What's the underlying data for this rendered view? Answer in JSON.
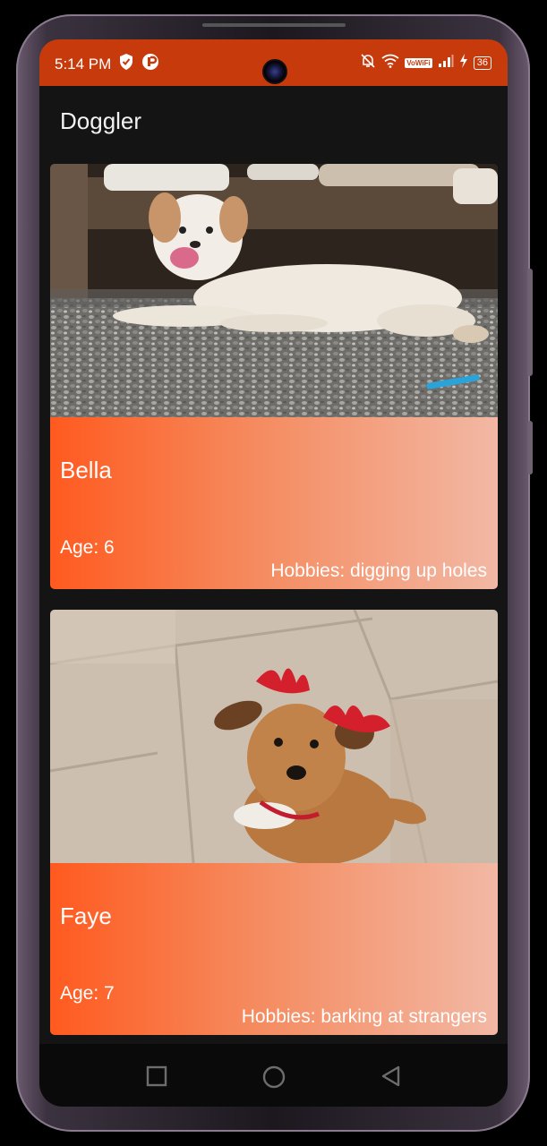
{
  "status_bar": {
    "time": "5:14 PM",
    "battery": "36",
    "background": "#c63a0c"
  },
  "app": {
    "title": "Doggler",
    "background": "#141414"
  },
  "dogs": [
    {
      "name": "Bella",
      "age": "Age: 6",
      "hobbies": "Hobbies: digging up holes",
      "image": "white fluffy dog lying on gravel"
    },
    {
      "name": "Faye",
      "age": "Age: 7",
      "hobbies": "Hobbies: barking at strangers",
      "image": "brown terrier wearing red reindeer antlers on tile floor"
    }
  ],
  "nav": {
    "icons": [
      "recents-icon",
      "home-icon",
      "back-icon"
    ]
  },
  "colors": {
    "card_gradient_start": "#ff5a1f",
    "card_gradient_end": "#f2b8a4",
    "accent": "#c63a0c"
  }
}
